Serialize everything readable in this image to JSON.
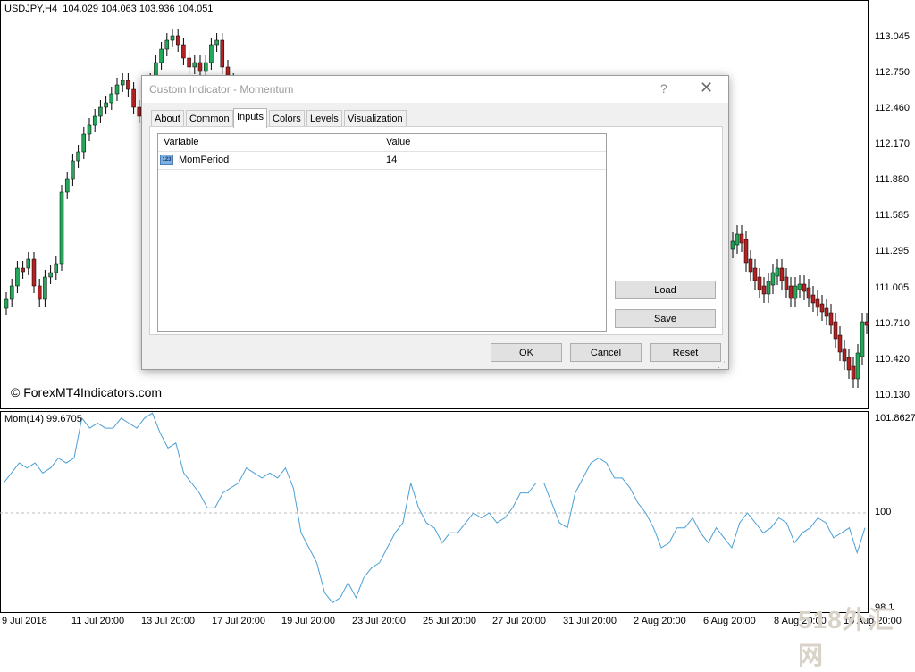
{
  "chart": {
    "header": "USDJPY,H4  104.029 104.063 103.936 104.051",
    "copyright": "© ForexMT4Indicators.com",
    "watermark": "518外汇网",
    "price_labels": [
      "113.045",
      "112.750",
      "112.460",
      "112.170",
      "111.880",
      "111.585",
      "111.295",
      "111.005",
      "110.710",
      "110.420",
      "110.130"
    ],
    "indicator_header": "Mom(14) 99.6705",
    "indicator_labels": [
      "101.8627",
      "100",
      "98.1"
    ],
    "time_labels": [
      "9 Jul 2018",
      "11 Jul 20:00",
      "13 Jul 20:00",
      "17 Jul 20:00",
      "19 Jul 20:00",
      "23 Jul 20:00",
      "25 Jul 20:00",
      "27 Jul 20:00",
      "31 Jul 20:00",
      "2 Aug 20:00",
      "6 Aug 20:00",
      "8 Aug 20:00",
      "10 Aug 20:00"
    ],
    "colors": {
      "bull": "#26a65b",
      "bear": "#b22222",
      "indicator_line": "#4a9fd6",
      "level_line": "#bbbbbb"
    }
  },
  "chart_data": {
    "type": "line",
    "title": "Mom(14) 99.6705",
    "series": [
      {
        "name": "Mom(14)",
        "values": [
          100.6,
          100.8,
          101.0,
          100.9,
          101.0,
          100.8,
          100.9,
          101.1,
          101.0,
          101.1,
          101.9,
          101.7,
          101.8,
          101.7,
          101.7,
          101.9,
          101.8,
          101.7,
          101.9,
          102.0,
          101.6,
          101.3,
          101.4,
          100.8,
          100.6,
          100.4,
          100.1,
          100.1,
          100.4,
          100.5,
          100.6,
          100.9,
          100.8,
          100.7,
          100.8,
          100.7,
          100.9,
          100.5,
          99.6,
          99.3,
          99.0,
          98.4,
          98.2,
          98.3,
          98.6,
          98.3,
          98.7,
          98.9,
          99.0,
          99.3,
          99.6,
          99.8,
          100.6,
          100.1,
          99.8,
          99.7,
          99.4,
          99.6,
          99.6,
          99.8,
          100.0,
          99.9,
          100.0,
          99.8,
          99.9,
          100.1,
          100.4,
          100.4,
          100.6,
          100.6,
          100.2,
          99.8,
          99.7,
          100.4,
          100.7,
          101.0,
          101.1,
          101.0,
          100.7,
          100.7,
          100.5,
          100.2,
          100.0,
          99.7,
          99.3,
          99.4,
          99.7,
          99.7,
          99.9,
          99.6,
          99.4,
          99.7,
          99.5,
          99.3,
          99.8,
          100.0,
          99.8,
          99.6,
          99.7,
          99.9,
          99.8,
          99.4,
          99.6,
          99.7,
          99.9,
          99.8,
          99.5,
          99.6,
          99.7,
          99.2,
          99.7
        ]
      }
    ],
    "ylim": [
      98.1,
      101.8627
    ],
    "reference_line": 100
  },
  "dialog": {
    "title": "Custom Indicator - Momentum",
    "help_glyph": "?",
    "close_glyph": "✕",
    "tabs": [
      "About",
      "Common",
      "Inputs",
      "Colors",
      "Levels",
      "Visualization"
    ],
    "active_tab": "Inputs",
    "grid": {
      "columns": [
        "Variable",
        "Value"
      ],
      "rows": [
        {
          "icon": "123",
          "variable": "MomPeriod",
          "value": "14"
        }
      ]
    },
    "buttons": {
      "load": "Load",
      "save": "Save",
      "ok": "OK",
      "cancel": "Cancel",
      "reset": "Reset"
    }
  }
}
